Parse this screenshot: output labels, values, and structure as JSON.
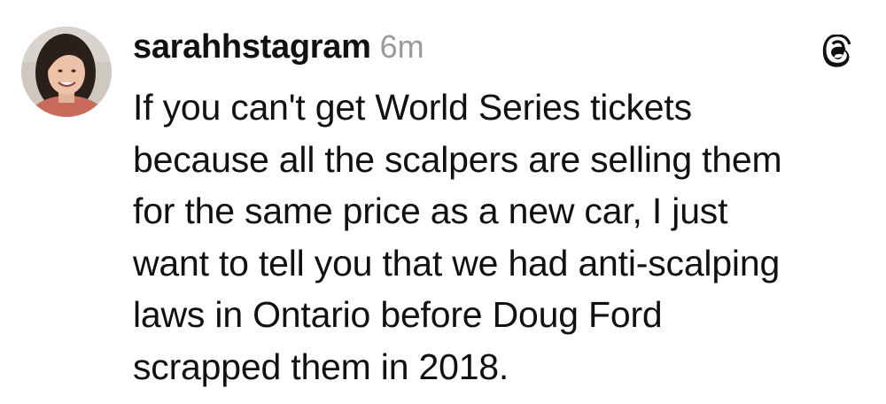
{
  "post": {
    "username": "sarahhstagram",
    "timestamp": "6m",
    "avatar_icon": "profile-photo-avatar",
    "app_icon": "threads-logo-icon",
    "body_lines": [
      "If you can't get World Series tickets",
      "because all the scalpers are selling them",
      "for the same price as a new car, I just",
      "want to tell you that we had anti-scalping",
      "laws in Ontario before Doug Ford",
      "scrapped them in 2018."
    ]
  },
  "colors": {
    "text": "#111111",
    "timestamp": "#9a9a9a",
    "background": "#ffffff"
  }
}
